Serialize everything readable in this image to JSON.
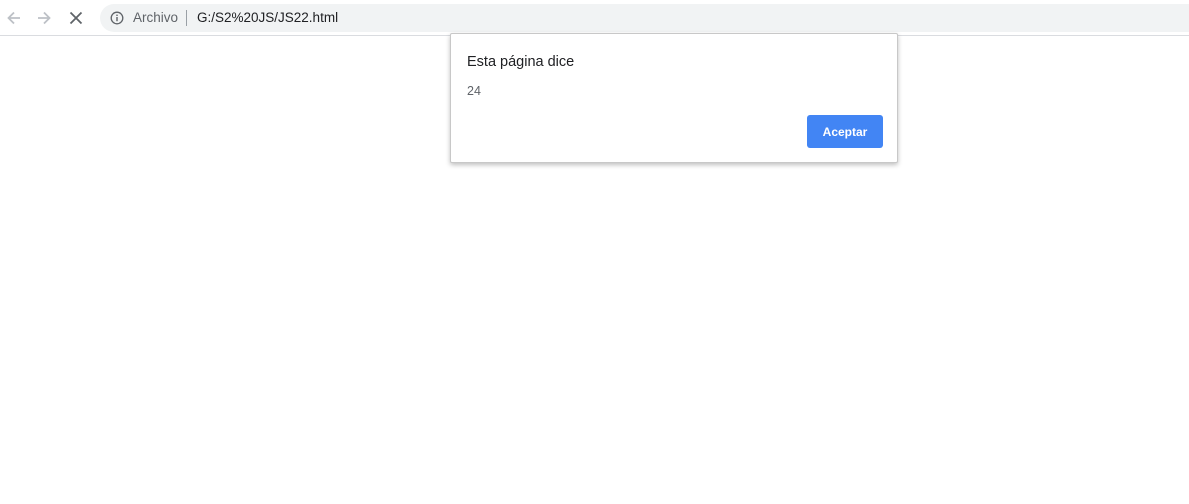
{
  "browser": {
    "back_icon": "arrow-left-icon",
    "forward_icon": "arrow-right-icon",
    "stop_icon": "close-icon",
    "info_icon": "info-icon",
    "scheme_label": "Archivo",
    "url": "G:/S2%20JS/JS22.html"
  },
  "dialog": {
    "title": "Esta página dice",
    "message": "24",
    "accept_label": "Aceptar",
    "accent_color": "#4285f4"
  }
}
